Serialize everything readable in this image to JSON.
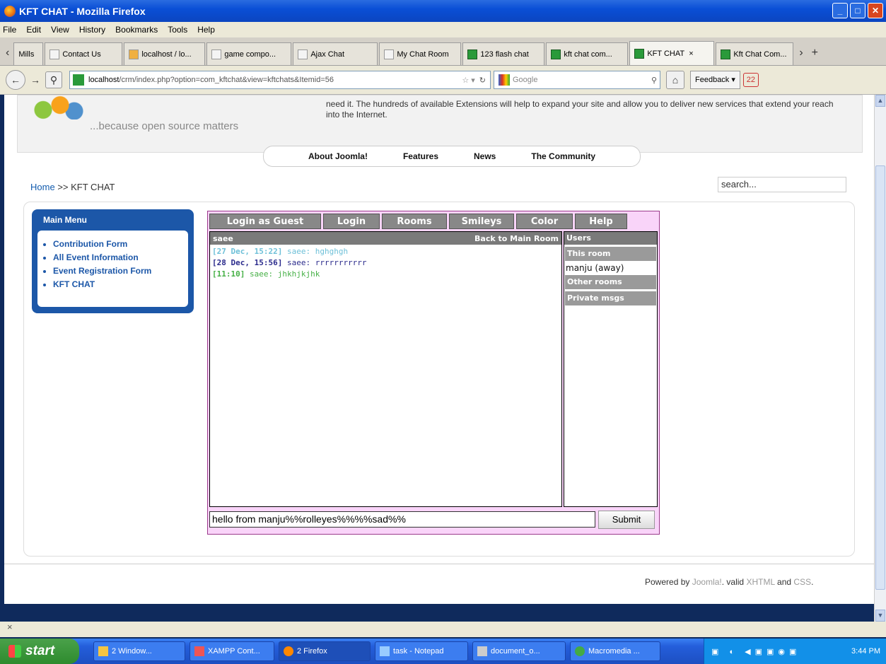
{
  "window": {
    "title": "KFT CHAT - Mozilla Firefox"
  },
  "menubar": {
    "items": [
      "File",
      "Edit",
      "View",
      "History",
      "Bookmarks",
      "Tools",
      "Help"
    ]
  },
  "tabs": [
    {
      "label": "Mills"
    },
    {
      "label": "Contact Us"
    },
    {
      "label": "localhost / lo..."
    },
    {
      "label": "game compo..."
    },
    {
      "label": "Ajax Chat"
    },
    {
      "label": "My Chat Room"
    },
    {
      "label": "123 flash chat"
    },
    {
      "label": "kft chat com..."
    },
    {
      "label": "KFT CHAT",
      "active": true
    },
    {
      "label": "Kft Chat Com..."
    }
  ],
  "navbar": {
    "url_host": "localhost",
    "url_path": "/crm/index.php?option=com_kftchat&view=kftchats&Itemid=56",
    "search_placeholder": "Google",
    "feedback": "Feedback",
    "badge": "22"
  },
  "header": {
    "tagline": "...because open source matters",
    "intro": "need it. The hundreds of available Extensions will help to expand your site and allow you to deliver new services that extend your reach into the Internet.",
    "nav": [
      "About Joomla!",
      "Features",
      "News",
      "The Community"
    ]
  },
  "breadcrumb": {
    "home": "Home",
    "sep": ">>",
    "current": "KFT CHAT"
  },
  "search": {
    "value": "search..."
  },
  "main_menu": {
    "title": "Main Menu",
    "items": [
      "Contribution Form",
      "All Event Information",
      "Event Registration Form",
      "KFT CHAT"
    ]
  },
  "chat": {
    "tabs": [
      "Login as Guest",
      "Login",
      "Rooms",
      "Smileys",
      "Color",
      "Help"
    ],
    "room_user": "saee",
    "back_link": "Back to Main Room",
    "messages": [
      {
        "time": "[27 Dec, 15:22]",
        "text": "saee: hghghgh",
        "color": "#6ec0d8"
      },
      {
        "time": "[28 Dec, 15:56]",
        "text": "saee: rrrrrrrrrrr",
        "color": "#2b2b8c"
      },
      {
        "time": "[11:10]",
        "text": "saee: jhkhjkjhk",
        "color": "#46b046"
      }
    ],
    "users_header": "Users",
    "this_room": "This room",
    "user_entry": "manju (away)",
    "other_rooms": "Other rooms",
    "private_msgs": "Private msgs",
    "input_value": "hello from manju%%rolleyes%%%%sad%%",
    "submit": "Submit"
  },
  "footer": {
    "powered": "Powered by",
    "joomla": "Joomla!",
    "valid": ". valid",
    "xhtml": "XHTML",
    "and": "and",
    "css": "CSS",
    "end": "."
  },
  "findbar": {
    "close": "×"
  },
  "taskbar": {
    "start": "start",
    "buttons": [
      "2 Window...",
      "XAMPP Cont...",
      "2 Firefox",
      "task - Notepad",
      "document_o...",
      "Macromedia ..."
    ],
    "time": "3:44 PM"
  },
  "colors": {
    "chat_border": "#9b3a8c",
    "chat_bg": "#f9d4f9",
    "menu_blue": "#1c57a8"
  }
}
